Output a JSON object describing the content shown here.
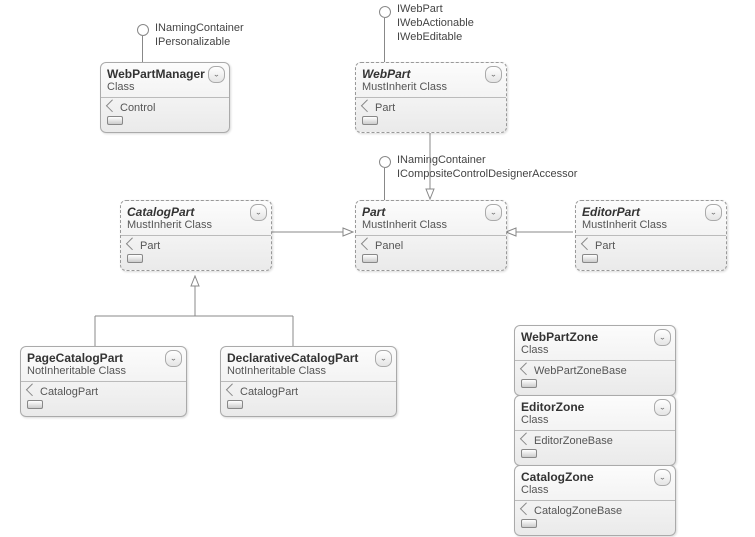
{
  "interfaces": {
    "wpm": [
      "INamingContainer",
      "IPersonalizable"
    ],
    "webpart": [
      "IWebPart",
      "IWebActionable",
      "IWebEditable"
    ],
    "part": [
      "INamingContainer",
      "ICompositeControlDesignerAccessor"
    ]
  },
  "classes": {
    "wpm": {
      "name": "WebPartManager",
      "kind": "Class",
      "base": "Control",
      "abstract": false
    },
    "webpart": {
      "name": "WebPart",
      "kind": "MustInherit Class",
      "base": "Part",
      "abstract": true
    },
    "catalogpart": {
      "name": "CatalogPart",
      "kind": "MustInherit Class",
      "base": "Part",
      "abstract": true
    },
    "part": {
      "name": "Part",
      "kind": "MustInherit Class",
      "base": "Panel",
      "abstract": true
    },
    "editorpart": {
      "name": "EditorPart",
      "kind": "MustInherit Class",
      "base": "Part",
      "abstract": true
    },
    "pagecat": {
      "name": "PageCatalogPart",
      "kind": "NotInheritable Class",
      "base": "CatalogPart",
      "abstract": false
    },
    "declcat": {
      "name": "DeclarativeCatalogPart",
      "kind": "NotInheritable Class",
      "base": "CatalogPart",
      "abstract": false
    },
    "wpzone": {
      "name": "WebPartZone",
      "kind": "Class",
      "base": "WebPartZoneBase",
      "abstract": false
    },
    "edzone": {
      "name": "EditorZone",
      "kind": "Class",
      "base": "EditorZoneBase",
      "abstract": false
    },
    "catzone": {
      "name": "CatalogZone",
      "kind": "Class",
      "base": "CatalogZoneBase",
      "abstract": false
    }
  }
}
